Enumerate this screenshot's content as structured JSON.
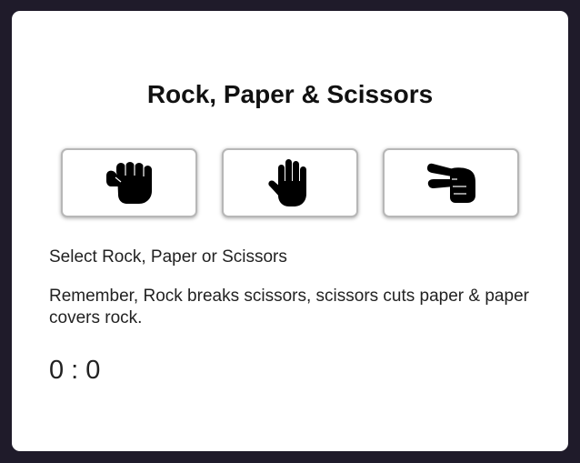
{
  "game": {
    "title": "Rock, Paper & Scissors",
    "choices": [
      {
        "name": "Rock",
        "icon": "fist-icon"
      },
      {
        "name": "Paper",
        "icon": "open-hand-icon"
      },
      {
        "name": "Scissors",
        "icon": "peace-hand-icon"
      }
    ],
    "instruction": "Select Rock, Paper or Scissors",
    "rules": "Remember, Rock breaks scissors, scissors cuts paper & paper covers rock.",
    "score": "0 : 0"
  },
  "colors": {
    "background": "#1f1b2a",
    "card": "#ffffff",
    "text": "#222222",
    "button_border": "#b7b7b7"
  }
}
